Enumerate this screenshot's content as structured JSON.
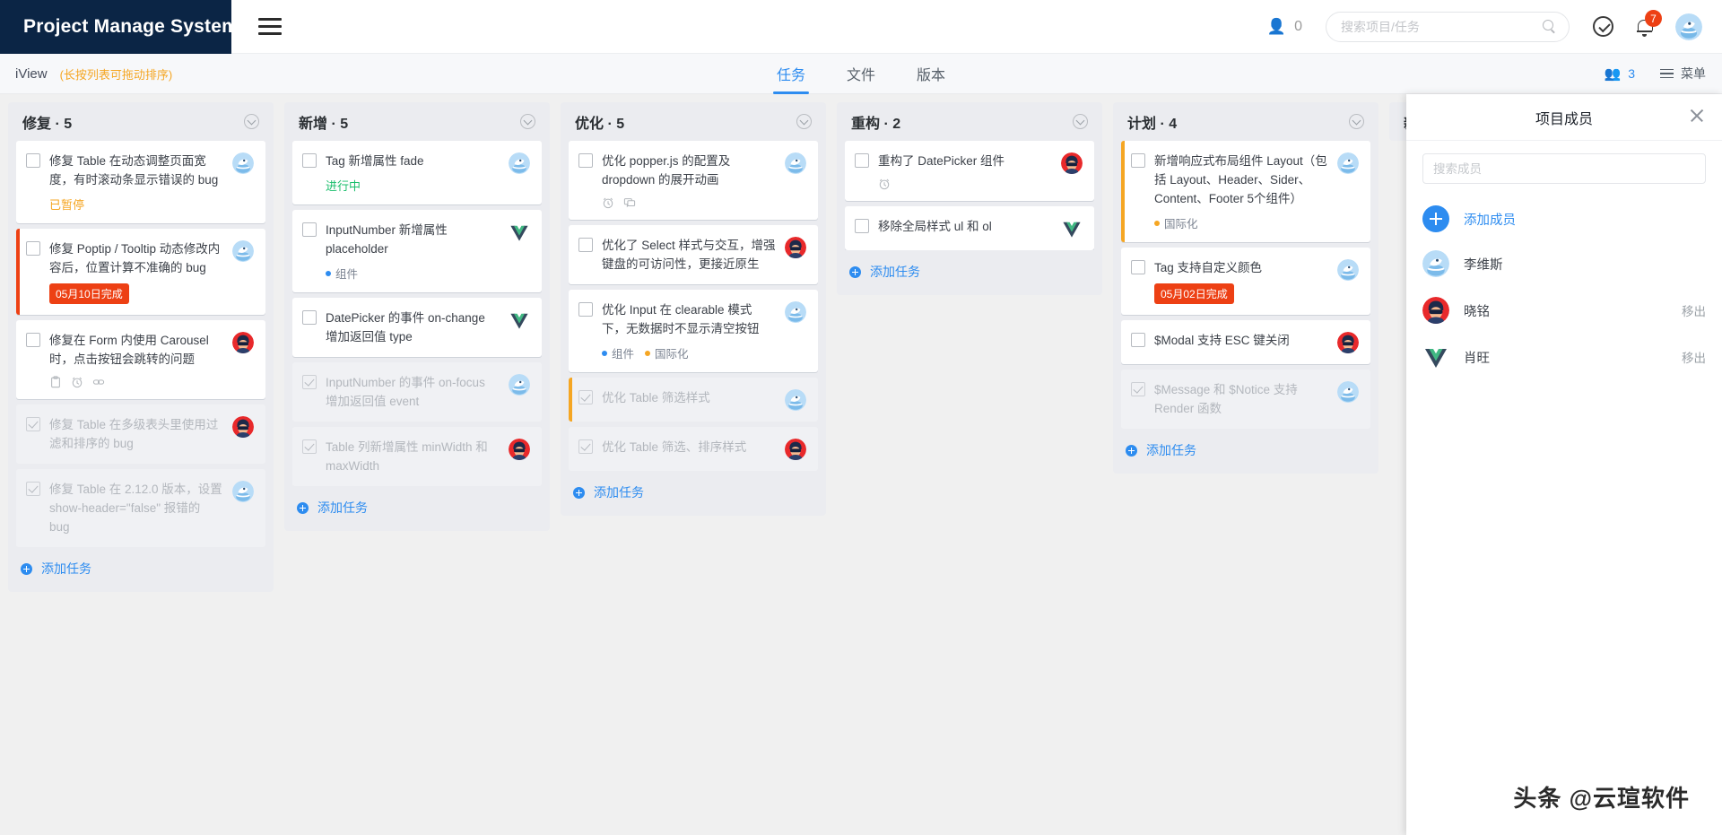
{
  "header": {
    "brand": "Project Manage System",
    "menu_icon": "hamburger-icon",
    "people_count": "0",
    "search_placeholder": "搜索项目/任务",
    "search_value": "",
    "notification_badge": "7",
    "icons": [
      "check-circle-icon",
      "bell-icon",
      "user-avatar"
    ]
  },
  "subheader": {
    "project_name": "iView",
    "hint": "(长按列表可拖动排序)",
    "tabs": [
      {
        "label": "任务",
        "active": true
      },
      {
        "label": "文件",
        "active": false
      },
      {
        "label": "版本",
        "active": false
      }
    ],
    "members_count": "3",
    "menu_label": "菜单"
  },
  "board": {
    "add_task_label": "添加任务",
    "columns": [
      {
        "title": "修复 · 5",
        "add_task": "添加任务",
        "cards": [
          {
            "text": "修复 Table 在动态调整页面宽度，有时滚动条显示错误的 bug",
            "status": {
              "text": "已暂停",
              "kind": "paused"
            },
            "avatar": "blue",
            "done": false,
            "bar": ""
          },
          {
            "text": "修复 Poptip / Tooltip 动态修改内容后，位置计算不准确的 bug",
            "date": "05月10日完成",
            "avatar": "blue",
            "done": false,
            "bar": "red"
          },
          {
            "text": "修复在 Form 内使用 Carousel 时，点击按钮会跳转的问题",
            "icons": [
              "clipboard-icon",
              "alarm-icon",
              "link-icon"
            ],
            "avatar": "red",
            "done": false,
            "bar": ""
          },
          {
            "text": "修复 Table 在多级表头里使用过滤和排序的 bug",
            "avatar": "red",
            "done": true,
            "bar": ""
          },
          {
            "text": "修复 Table 在 2.12.0 版本，设置 show-header=\"false\" 报错的 bug",
            "avatar": "blue",
            "done": true,
            "bar": ""
          }
        ]
      },
      {
        "title": "新增 · 5",
        "add_task": "添加任务",
        "cards": [
          {
            "text": "Tag 新增属性 fade",
            "status": {
              "text": "进行中",
              "kind": "progress"
            },
            "avatar": "blue",
            "done": false,
            "bar": ""
          },
          {
            "text": "InputNumber 新增属性 placeholder",
            "tags": [
              {
                "label": "组件",
                "color": "#2d8cf0"
              }
            ],
            "avatar": "vue",
            "done": false,
            "bar": ""
          },
          {
            "text": "DatePicker 的事件 on-change 增加返回值 type",
            "avatar": "vue",
            "done": false,
            "bar": ""
          },
          {
            "text": "InputNumber 的事件 on-focus 增加返回值 event",
            "avatar": "blue",
            "done": true,
            "bar": ""
          },
          {
            "text": "Table 列新增属性 minWidth 和 maxWidth",
            "avatar": "red",
            "done": true,
            "bar": ""
          }
        ]
      },
      {
        "title": "优化 · 5",
        "add_task": "添加任务",
        "cards": [
          {
            "text": "优化 popper.js 的配置及 dropdown 的展开动画",
            "icons": [
              "alarm-icon",
              "comment-icon"
            ],
            "avatar": "blue",
            "done": false,
            "bar": ""
          },
          {
            "text": "优化了 Select 样式与交互，增强键盘的可访问性，更接近原生",
            "avatar": "red",
            "done": false,
            "bar": ""
          },
          {
            "text": "优化 Input 在 clearable 模式下，无数据时不显示清空按钮",
            "tags": [
              {
                "label": "组件",
                "color": "#2d8cf0"
              },
              {
                "label": "国际化",
                "color": "#f5a623"
              }
            ],
            "avatar": "blue",
            "done": false,
            "bar": ""
          },
          {
            "text": "优化 Table 筛选样式",
            "avatar": "blue",
            "done": true,
            "bar": "orange"
          },
          {
            "text": "优化 Table 筛选、排序样式",
            "avatar": "red",
            "done": true,
            "bar": ""
          }
        ]
      },
      {
        "title": "重构 · 2",
        "add_task": "添加任务",
        "cards": [
          {
            "text": "重构了 DatePicker 组件",
            "icons": [
              "alarm-icon"
            ],
            "avatar": "red",
            "done": false,
            "bar": ""
          },
          {
            "text": "移除全局样式 ul 和 ol",
            "avatar": "vue",
            "done": false,
            "bar": ""
          }
        ]
      },
      {
        "title": "计划 · 4",
        "add_task": "添加任务",
        "cards": [
          {
            "text": "新增响应式布局组件 Layout（包括 Layout、Header、Sider、Content、Footer 5个组件）",
            "tags": [
              {
                "label": "国际化",
                "color": "#f5a623"
              }
            ],
            "avatar": "blue",
            "done": false,
            "bar": "orange"
          },
          {
            "text": "Tag 支持自定义颜色",
            "date": "05月02日完成",
            "avatar": "blue",
            "done": false,
            "bar": ""
          },
          {
            "text": "$Modal 支持 ESC 键关闭",
            "avatar": "red",
            "done": false,
            "bar": ""
          },
          {
            "text": "$Message 和 $Notice 支持 Render 函数",
            "avatar": "blue",
            "done": true,
            "bar": ""
          }
        ]
      },
      {
        "title": "新",
        "add_task": "",
        "cards": []
      }
    ]
  },
  "drawer": {
    "title": "项目成员",
    "close_icon": "close-icon",
    "search_placeholder": "搜索成员",
    "search_value": "",
    "add_member_label": "添加成员",
    "members": [
      {
        "name": "李维斯",
        "avatar": "blue",
        "action": ""
      },
      {
        "name": "晓铭",
        "avatar": "red",
        "action": "移出"
      },
      {
        "name": "肖旺",
        "avatar": "vue",
        "action": "移出"
      }
    ]
  },
  "watermark": "头条 @云瑄软件"
}
